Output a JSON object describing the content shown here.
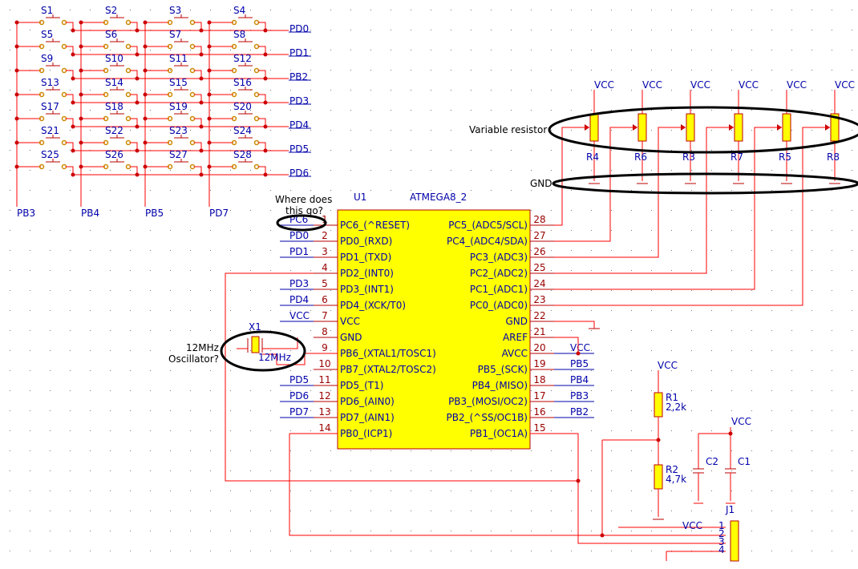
{
  "switches": [
    [
      "S1",
      "S2",
      "S3",
      "S4"
    ],
    [
      "S5",
      "S6",
      "S7",
      "S8"
    ],
    [
      "S9",
      "S10",
      "S11",
      "S12"
    ],
    [
      "S13",
      "S14",
      "S15",
      "S16"
    ],
    [
      "S17",
      "S18",
      "S19",
      "S20"
    ],
    [
      "S21",
      "S22",
      "S23",
      "S24"
    ],
    [
      "S25",
      "S26",
      "S27",
      "S28"
    ]
  ],
  "row_nets": [
    "PD0",
    "PD1",
    "PB2",
    "PD3",
    "PD4",
    "PD5",
    "PD6"
  ],
  "col_nets": [
    "PB3",
    "PB4",
    "PB5",
    "PD7"
  ],
  "ic": {
    "ref": "U1",
    "part": "ATMEGA8_2",
    "left_pins": [
      {
        "num": "1",
        "name": "PC6_(^RESET)",
        "net": "PC6"
      },
      {
        "num": "2",
        "name": "PD0_(RXD)",
        "net": "PD0"
      },
      {
        "num": "3",
        "name": "PD1_(TXD)",
        "net": "PD1"
      },
      {
        "num": "4",
        "name": "PD2_(INT0)",
        "net": ""
      },
      {
        "num": "5",
        "name": "PD3_(INT1)",
        "net": "PD3"
      },
      {
        "num": "6",
        "name": "PD4_(XCK/T0)",
        "net": "PD4"
      },
      {
        "num": "7",
        "name": "VCC",
        "net": "VCC"
      },
      {
        "num": "8",
        "name": "GND",
        "net": ""
      },
      {
        "num": "9",
        "name": "PB6_(XTAL1/TOSC1)",
        "net": ""
      },
      {
        "num": "10",
        "name": "PB7_(XTAL2/TOSC2)",
        "net": ""
      },
      {
        "num": "11",
        "name": "PD5_(T1)",
        "net": "PD5"
      },
      {
        "num": "12",
        "name": "PD6_(AIN0)",
        "net": "PD6"
      },
      {
        "num": "13",
        "name": "PD7_(AIN1)",
        "net": "PD7"
      },
      {
        "num": "14",
        "name": "PB0_(ICP1)",
        "net": ""
      }
    ],
    "right_pins": [
      {
        "num": "28",
        "name": "PC5_(ADC5/SCL)",
        "net": ""
      },
      {
        "num": "27",
        "name": "PC4_(ADC4/SDA)",
        "net": ""
      },
      {
        "num": "26",
        "name": "PC3_(ADC3)",
        "net": ""
      },
      {
        "num": "25",
        "name": "PC2_(ADC2)",
        "net": ""
      },
      {
        "num": "24",
        "name": "PC1_(ADC1)",
        "net": ""
      },
      {
        "num": "23",
        "name": "PC0_(ADC0)",
        "net": ""
      },
      {
        "num": "22",
        "name": "GND",
        "net": ""
      },
      {
        "num": "21",
        "name": "AREF",
        "net": ""
      },
      {
        "num": "20",
        "name": "AVCC",
        "net": "VCC"
      },
      {
        "num": "19",
        "name": "PB5_(SCK)",
        "net": "PB5"
      },
      {
        "num": "18",
        "name": "PB4_(MISO)",
        "net": "PB4"
      },
      {
        "num": "17",
        "name": "PB3_(MOSI/OC2)",
        "net": "PB3"
      },
      {
        "num": "16",
        "name": "PB2_(^SS/OC1B)",
        "net": "PB2"
      },
      {
        "num": "15",
        "name": "PB1_(OC1A)",
        "net": ""
      }
    ]
  },
  "pots": {
    "labels": [
      "R4",
      "R6",
      "R3",
      "R7",
      "R5",
      "R8"
    ],
    "supply": "VCC"
  },
  "crystal": {
    "ref": "X1",
    "value": "12MHz"
  },
  "resistors": [
    {
      "ref": "R1",
      "value": "2,2k"
    },
    {
      "ref": "R2",
      "value": "4,7k"
    }
  ],
  "caps": [
    {
      "ref": "C2"
    },
    {
      "ref": "C1"
    }
  ],
  "cap_supply": "VCC",
  "divider_supply": "VCC",
  "connector": {
    "ref": "J1",
    "pins": [
      "1",
      "2",
      "3",
      "4"
    ],
    "net_label": "VCC"
  },
  "annotations": {
    "where_line1": "Where does",
    "where_line2": "this go?",
    "variable_resistor": "Variable resistor",
    "gnd": "GND",
    "osc_line1": "12MHz",
    "osc_line2": "Oscillator?"
  },
  "colors": {
    "wire": "#ff0000",
    "pin": "#bb0000",
    "text": "#0000aa",
    "ic_fill": "#ffff00",
    "junction": "#cc0000"
  }
}
